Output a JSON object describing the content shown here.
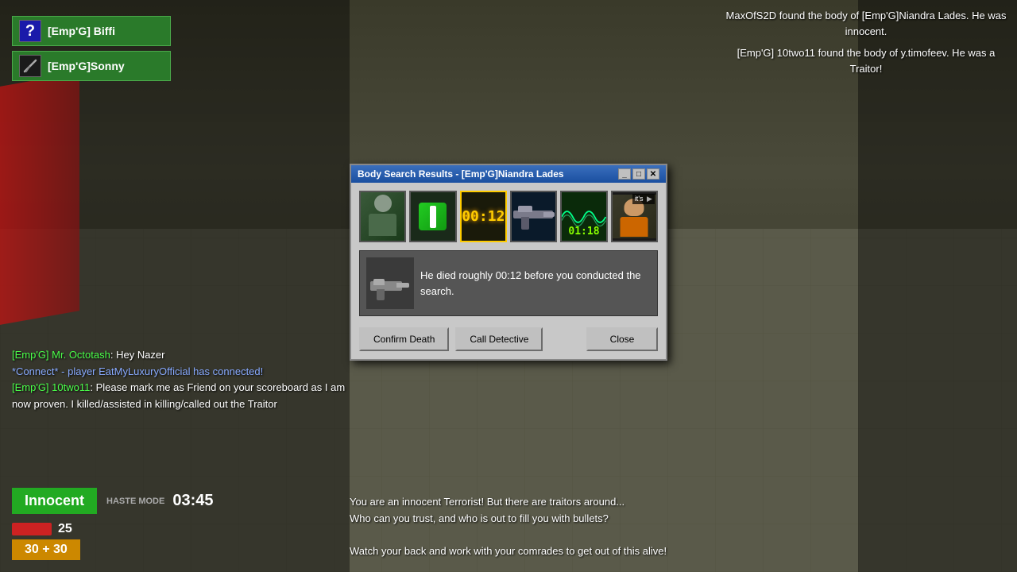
{
  "game": {
    "background": "game scene",
    "notifications": {
      "line1": "MaxOfS2D found the body of [Emp'G]Niandra Lades. He was innocent.",
      "line2": "[Emp'G] 10two11 found the body of y.timofeev. He was a Traitor!"
    }
  },
  "players": [
    {
      "name": "[Emp'G] Biffi",
      "icon_type": "question"
    },
    {
      "name": "[Emp'G]Sonny",
      "icon_type": "knife"
    }
  ],
  "chat": [
    {
      "speaker": "[Emp'G] Mr. Octotash",
      "text": " Hey Nazer",
      "type": "player"
    },
    {
      "text": "*Connect* - player EatMyLuxuryOfficial has connected!",
      "type": "connect"
    },
    {
      "speaker": "[Emp'G] 10two11",
      "text": ": Please mark me as Friend on your scoreboard as I am now proven. I killed/assisted in killing/called out the Traitor",
      "type": "player"
    }
  ],
  "hud": {
    "role": "Innocent",
    "mode_label": "HASTE MODE",
    "time": "03:45",
    "health": 25,
    "ammo": "30 + 30"
  },
  "bottom_message": {
    "line1": "You are an innocent Terrorist! But there are traitors around...",
    "line2": "Who can you trust, and who is out to fill you with bullets?",
    "line3": "",
    "line4": "Watch your back and work with your comrades to get out of this alive!"
  },
  "modal": {
    "title": "Body Search Results - [Emp'G]Niandra Lades",
    "controls": {
      "minimize": "_",
      "maximize": "□",
      "close": "✕"
    },
    "evidence_slots": [
      {
        "type": "avatar",
        "label": ""
      },
      {
        "type": "green_pill",
        "label": ""
      },
      {
        "type": "timer",
        "value": "00:12",
        "active": true
      },
      {
        "type": "gun",
        "label": ""
      },
      {
        "type": "wave",
        "timer": "01:18",
        "label": ""
      },
      {
        "type": "character",
        "label": "it's",
        "has_play": true
      }
    ],
    "info_text": "He died roughly 00:12 before you conducted the search.",
    "buttons": {
      "confirm_death": "Confirm Death",
      "call_detective": "Call Detective",
      "close": "Close"
    }
  }
}
